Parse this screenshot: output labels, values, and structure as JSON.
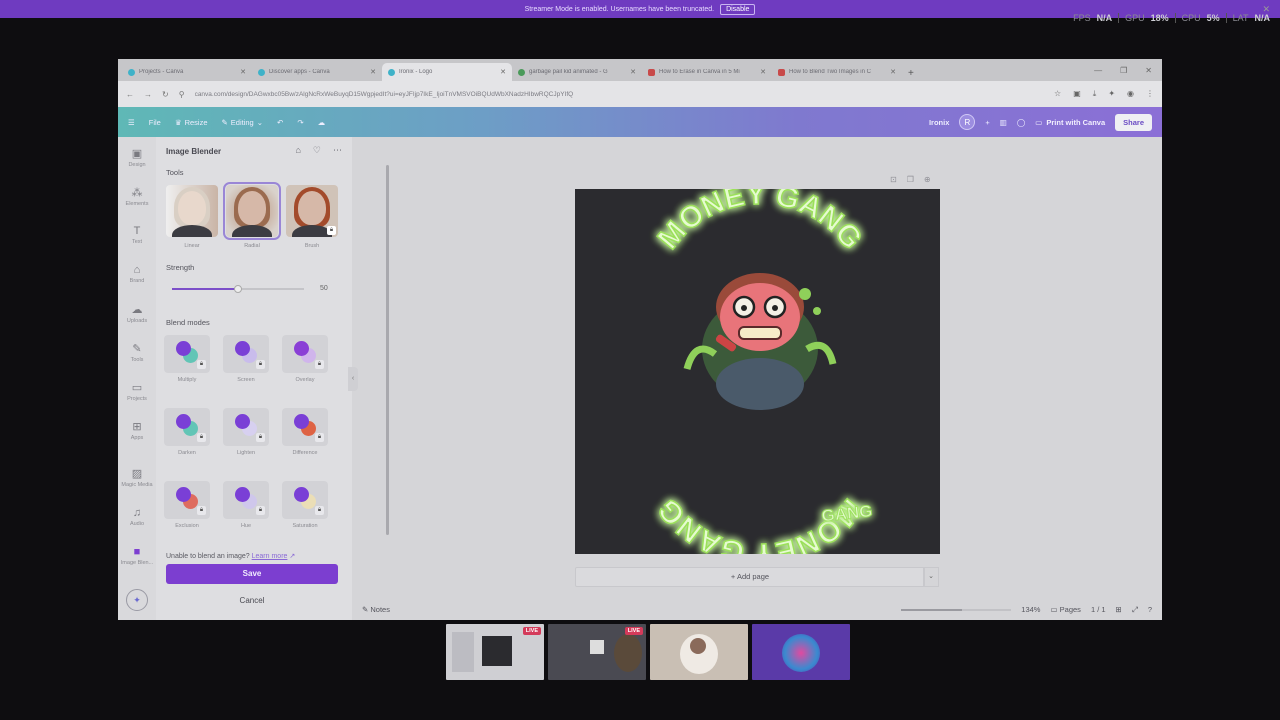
{
  "streamer": {
    "message": "Streamer Mode is enabled. Usernames have been truncated.",
    "disable_label": "Disable"
  },
  "stats": {
    "fps_label": "FPS",
    "fps_value": "N/A",
    "gpu_label": "GPU",
    "gpu_value": "18%",
    "cpu_label": "CPU",
    "cpu_value": "5%",
    "lat_label": "LAT",
    "lat_value": "N/A"
  },
  "browser": {
    "tabs": [
      {
        "title": "Projects - Canva",
        "icon": "canva"
      },
      {
        "title": "Discover apps - Canva",
        "icon": "canva"
      },
      {
        "title": "Ironix - Logo",
        "icon": "canva",
        "active": true
      },
      {
        "title": "garbage pail kid animated - G",
        "icon": "google"
      },
      {
        "title": "How to Erase in Canva in 5 Mi",
        "icon": "youtube"
      },
      {
        "title": "How to Blend Two Images in C",
        "icon": "youtube"
      }
    ],
    "url": "canva.com/design/DAGwxbc05Bw/zAlgNcRxWeBuyqD15WgpjedIt?ui=eyJFIjp7IkE_IjoiTnVMSVOiBQUdWbXNadzHIbwRQCJpYIfQ"
  },
  "canva": {
    "header": {
      "file": "File",
      "resize": "Resize",
      "editing": "Editing",
      "team_name": "Ironix",
      "avatar_letter": "R",
      "print": "Print with Canva",
      "share": "Share"
    },
    "nav": [
      {
        "label": "Design",
        "icon": "design-icon"
      },
      {
        "label": "Elements",
        "icon": "elements-icon"
      },
      {
        "label": "Text",
        "icon": "text-icon"
      },
      {
        "label": "Brand",
        "icon": "brand-icon"
      },
      {
        "label": "Uploads",
        "icon": "uploads-icon"
      },
      {
        "label": "Tools",
        "icon": "tools-icon"
      },
      {
        "label": "Projects",
        "icon": "projects-icon"
      },
      {
        "label": "Apps",
        "icon": "apps-icon"
      },
      {
        "label": "Magic Media",
        "icon": "magic-media-icon"
      },
      {
        "label": "Audio",
        "icon": "audio-icon"
      },
      {
        "label": "Image Blen...",
        "icon": "image-blender-icon"
      }
    ],
    "panel": {
      "title": "Image Blender",
      "tools_label": "Tools",
      "tools": [
        {
          "label": "Linear"
        },
        {
          "label": "Radial",
          "selected": true
        },
        {
          "label": "Brush",
          "locked": true
        }
      ],
      "strength_label": "Strength",
      "strength_value": "50",
      "strength_fraction": 0.5,
      "blend_label": "Blend modes",
      "modes": [
        {
          "label": "Multiply",
          "c1": "#7a3fd6",
          "c2": "#4fc3b0"
        },
        {
          "label": "Screen",
          "c1": "#7a3fd6",
          "c2": "#c8b8f0"
        },
        {
          "label": "Overlay",
          "c1": "#8a3fd6",
          "c2": "#d0b0f0"
        },
        {
          "label": "Darken",
          "c1": "#7a3fd6",
          "c2": "#4fc3b0"
        },
        {
          "label": "Lighten",
          "c1": "#7a3fd6",
          "c2": "#d8d0f5"
        },
        {
          "label": "Difference",
          "c1": "#7a3fd6",
          "c2": "#e0502a"
        },
        {
          "label": "Exclusion",
          "c1": "#7a3fd6",
          "c2": "#e05a4a"
        },
        {
          "label": "Hue",
          "c1": "#7a3fd6",
          "c2": "#cfc6f0"
        },
        {
          "label": "Saturation",
          "c1": "#7a3fd6",
          "c2": "#f0e0b0"
        }
      ],
      "unable_text": "Unable to blend an image?",
      "learn_more": "Learn more",
      "save": "Save",
      "cancel": "Cancel"
    },
    "design": {
      "top_text": "MONEY GANG",
      "bottom_text": "MONEY GANG",
      "small_text": "GANG"
    },
    "add_page": "+ Add page",
    "bottom": {
      "notes": "Notes",
      "zoom": "134%",
      "zoom_fraction": 0.55,
      "pages_label": "Pages",
      "pages_value": "1 / 1"
    }
  },
  "thumbs": {
    "live1": "LIVE",
    "live2": "LIVE"
  },
  "colors": {
    "accent": "#7c3ed0",
    "glow": "#b6f56a"
  }
}
